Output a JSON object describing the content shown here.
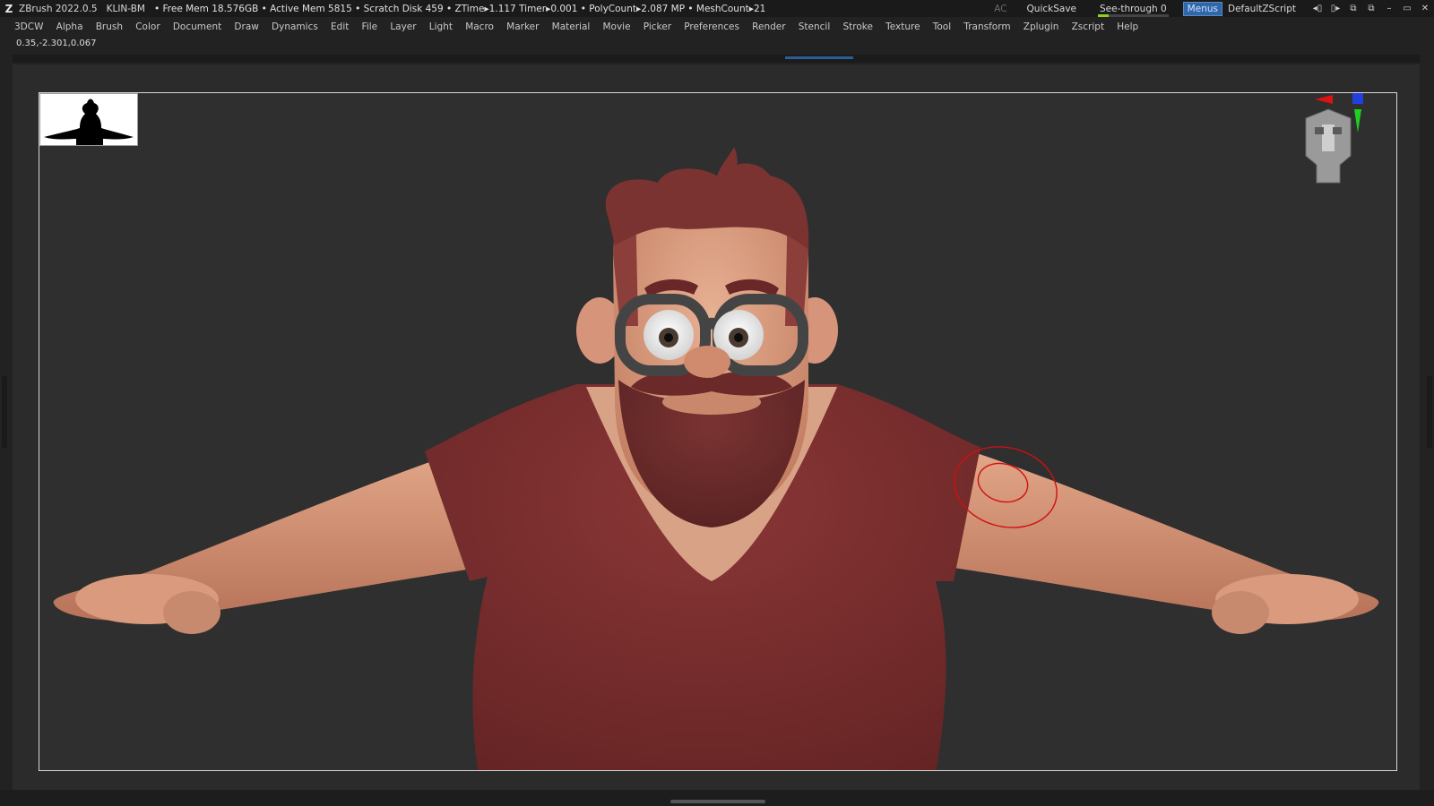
{
  "titlebar": {
    "app": "ZBrush 2022.0.5",
    "document": "KLIN-BM",
    "stats": "• Free Mem 18.576GB • Active Mem 5815 • Scratch Disk 459 • ZTime▸1.117 Timer▸0.001 • PolyCount▸2.087 MP • MeshCount▸21",
    "ac": "AC",
    "quicksave": "QuickSave",
    "seethrough": "See-through  0",
    "seethrough_level": 0,
    "menus": "Menus",
    "default_zscript": "DefaultZScript"
  },
  "menubar": {
    "items": [
      "3DCW",
      "Alpha",
      "Brush",
      "Color",
      "Document",
      "Draw",
      "Dynamics",
      "Edit",
      "File",
      "Layer",
      "Light",
      "Macro",
      "Marker",
      "Material",
      "Movie",
      "Picker",
      "Preferences",
      "Render",
      "Stencil",
      "Stroke",
      "Texture",
      "Tool",
      "Transform",
      "Zplugin",
      "Zscript",
      "Help"
    ]
  },
  "coords": "0.35,-2.301,0.067",
  "colors": {
    "shirt": "#7a2e2e",
    "skin": "#d89a7c",
    "hair": "#6e2f2f",
    "accent": "#2f67a8",
    "brush_cursor": "#d01010"
  },
  "icons": {
    "logo": "zbrush-logo",
    "navigation_head": "navigation-head-icon",
    "axis": "axis-gizmo-icon",
    "brush_cursor": "brush-cursor-icon"
  }
}
